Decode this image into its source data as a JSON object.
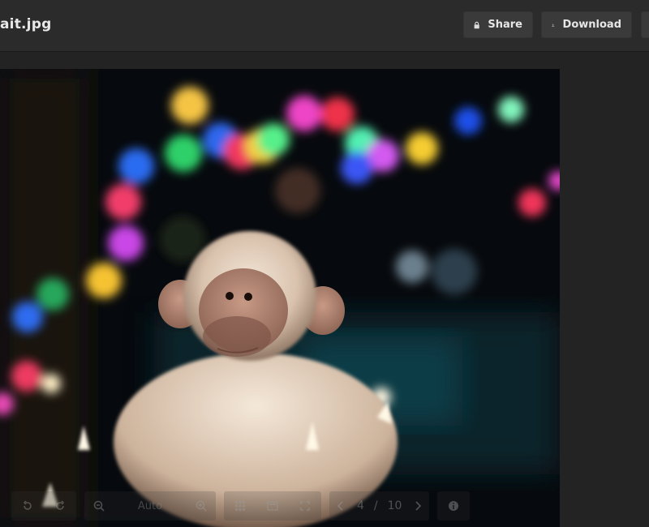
{
  "header": {
    "filename": "ait.jpg",
    "share_label": "Share",
    "download_label": "Download"
  },
  "viewer": {
    "zoom_value": "Auto",
    "page_current": "4",
    "page_separator": "/",
    "page_total": "10"
  },
  "icons": {
    "share": "lock-icon",
    "download": "download-icon",
    "rotate_left": "rotate-left-icon",
    "rotate_right": "rotate-right-icon",
    "zoom_out": "zoom-out-icon",
    "zoom_in": "zoom-in-icon",
    "grid": "grid-icon",
    "slideshow": "slideshow-icon",
    "prev": "chevron-left-icon",
    "next": "chevron-right-icon",
    "info": "info-icon"
  },
  "colors": {
    "topbar_bg": "#2b2b2b",
    "button_bg": "#3a3a3a",
    "page_bg": "#232323"
  }
}
